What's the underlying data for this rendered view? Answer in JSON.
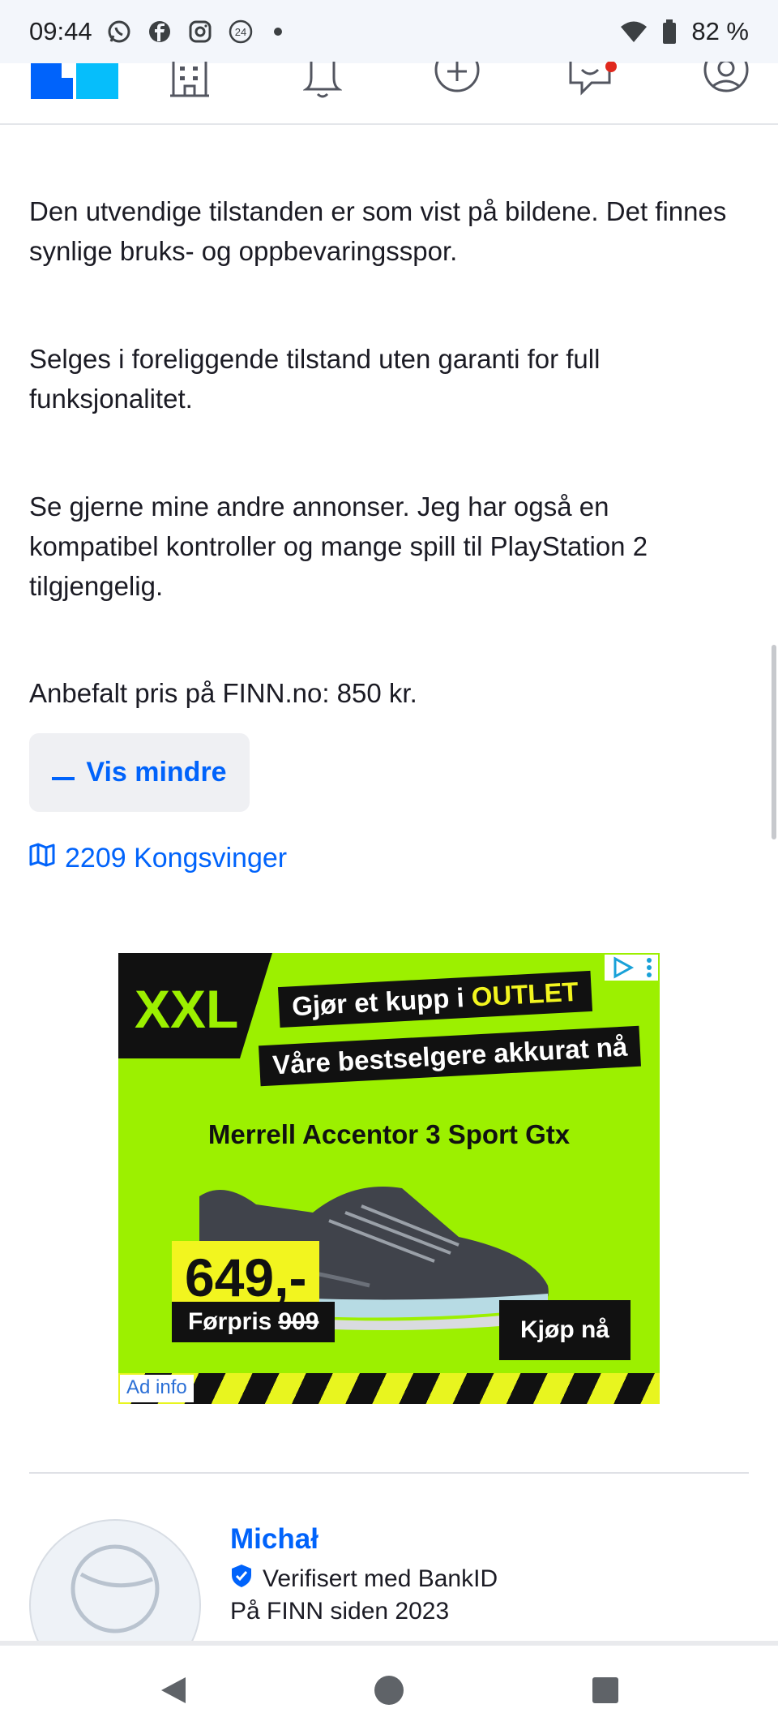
{
  "status_bar": {
    "time": "09:44",
    "battery": "82 %",
    "app_icons": [
      "whatsapp-icon",
      "facebook-icon",
      "instagram-icon",
      "news24-icon"
    ],
    "news_badge": "24"
  },
  "nav": {
    "items": [
      "finn-logo",
      "building-icon",
      "bell-icon",
      "plus-circle-icon",
      "messages-icon",
      "profile-icon"
    ],
    "has_notification_on": "messages"
  },
  "description": {
    "paragraphs": [
      "Den utvendige tilstanden er som vist på bildene. Det finnes synlige bruks- og oppbevaringsspor.",
      "Selges i foreliggende tilstand uten garanti for full funksjonalitet.",
      "Se gjerne mine andre annonser. Jeg har også en kompatibel kontroller og mange spill til PlayStation 2 tilgjengelig.",
      "Anbefalt pris på FINN.no: 850 kr."
    ],
    "show_less_label": "Vis mindre"
  },
  "location": {
    "text": "2209 Kongsvinger"
  },
  "ad": {
    "brand": "XXL",
    "banner_line1_prefix": "Gjør et kupp i ",
    "banner_line1_highlight": "OUTLET",
    "banner_line2": "Våre bestselgere akkurat nå",
    "product": "Merrell Accentor 3 Sport Gtx",
    "price": "649,-",
    "previous_price_label": "Førpris",
    "previous_price": "909",
    "cta": "Kjøp nå",
    "ad_info": "Ad info"
  },
  "seller": {
    "name": "Michał",
    "verified": "Verifisert med BankID",
    "since": "På FINN siden 2023"
  },
  "colors": {
    "link_blue": "#0063fb",
    "ad_green": "#9cf000",
    "ad_yellow": "#f2f51f"
  }
}
